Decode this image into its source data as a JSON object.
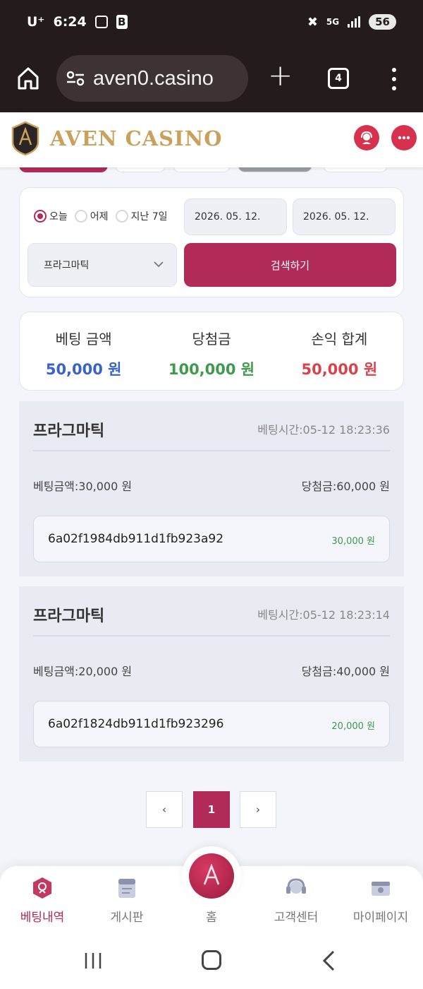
{
  "status_bar": {
    "carrier": "U⁺",
    "time": "6:24",
    "network": "5G",
    "battery": "56"
  },
  "browser": {
    "url": "aven0.casino",
    "tab_count": "4"
  },
  "site": {
    "logo_text": "AVEN CASINO"
  },
  "search": {
    "radio_options": [
      {
        "label": "오늘",
        "selected": true
      },
      {
        "label": "어제",
        "selected": false
      },
      {
        "label": "지난 7일",
        "selected": false
      }
    ],
    "date_from": "2026. 05. 12.",
    "date_to": "2026. 05. 12.",
    "provider_select": "프라그마틱",
    "search_button": "검색하기"
  },
  "summary": {
    "bet_label": "베팅 금액",
    "bet_value": "50,000 원",
    "win_label": "당첨금",
    "win_value": "100,000 원",
    "profit_label": "손익 합계",
    "profit_value": "50,000 원",
    "colors": {
      "bet": "#3a63c9",
      "win": "#3f9a4c",
      "profit": "#d8434b"
    }
  },
  "bets": [
    {
      "provider": "프라그마틱",
      "time": "베팅시간:05-12 18:23:36",
      "bet_amount": "베팅금액:30,000 원",
      "win_amount": "당첨금:60,000 원",
      "tx_id": "6a02f1984db911d1fb923a92",
      "tx_amount": "30,000 원"
    },
    {
      "provider": "프라그마틱",
      "time": "베팅시간:05-12 18:23:14",
      "bet_amount": "베팅금액:20,000 원",
      "win_amount": "당첨금:40,000 원",
      "tx_id": "6a02f1824db911d1fb923296",
      "tx_amount": "20,000 원"
    }
  ],
  "pagination": {
    "prev": "‹",
    "current": "1",
    "next": "›"
  },
  "bottom_nav": {
    "items": [
      {
        "label": "베팅내역",
        "icon": "betting-history-icon",
        "active": true
      },
      {
        "label": "게시판",
        "icon": "board-icon",
        "active": false
      },
      {
        "label": "홈",
        "icon": "home-logo-icon",
        "active": false
      },
      {
        "label": "고객센터",
        "icon": "headset-icon",
        "active": false
      },
      {
        "label": "마이페이지",
        "icon": "wallet-icon",
        "active": false
      }
    ]
  },
  "accent_color": "#b22a58"
}
